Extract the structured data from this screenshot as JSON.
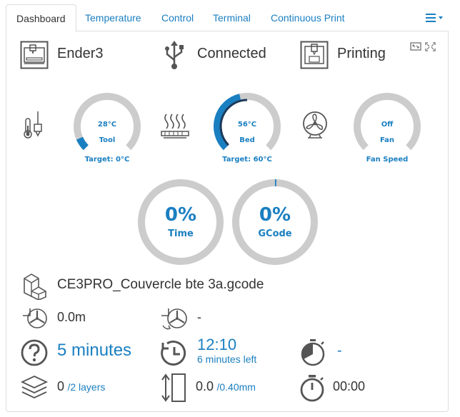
{
  "tabs": [
    {
      "label": "Dashboard",
      "active": true
    },
    {
      "label": "Temperature",
      "active": false
    },
    {
      "label": "Control",
      "active": false
    },
    {
      "label": "Terminal",
      "active": false
    },
    {
      "label": "Continuous Print",
      "active": false
    }
  ],
  "menu_icon": "list-icon",
  "status": {
    "printer_name": "Ender3",
    "connection": "Connected",
    "state": "Printing"
  },
  "gauges": {
    "tool": {
      "value": "28°C",
      "label": "Tool",
      "target": "Target: 0°C",
      "fraction": 0.08
    },
    "bed": {
      "value": "56°C",
      "label": "Bed",
      "target": "Target: 60°C",
      "fraction": 0.45,
      "target_fraction": 0.5
    },
    "fan": {
      "value": "Off",
      "label": "Fan",
      "target": "Fan Speed",
      "fraction": 0
    }
  },
  "progress": {
    "time": {
      "value": "0%",
      "label": "Time",
      "fraction": 0
    },
    "gcode": {
      "value": "0%",
      "label": "GCode",
      "fraction": 0.005
    }
  },
  "file": {
    "name": "CE3PRO_Couvercle bte 3a.gcode"
  },
  "stats": {
    "filament_used": "0.0m",
    "filament_remaining": "-",
    "estimated_time": "5 minutes",
    "eta_clock": "12:10",
    "eta_left": "6 minutes left",
    "timer_remaining": "-",
    "layer_current": "0",
    "layer_total": "/2 layers",
    "height_current": "0.0",
    "height_total": "/0.40mm",
    "elapsed": "00:00"
  },
  "colors": {
    "accent": "#1a7fc1",
    "gauge_track": "#cccccc",
    "dark_arc": "#1c3a5a"
  }
}
